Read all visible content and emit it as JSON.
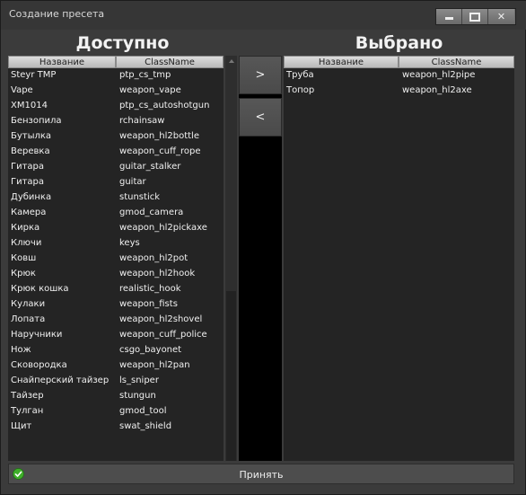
{
  "window": {
    "title": "Создание пресета",
    "controls": [
      "minimize",
      "maximize",
      "close"
    ]
  },
  "available": {
    "title": "Доступно",
    "columns": [
      "Название",
      "ClassName"
    ],
    "rows": [
      [
        "Steyr TMP",
        "ptp_cs_tmp"
      ],
      [
        "Vape",
        "weapon_vape"
      ],
      [
        "XM1014",
        "ptp_cs_autoshotgun"
      ],
      [
        "Бензопила",
        "rchainsaw"
      ],
      [
        "Бутылка",
        "weapon_hl2bottle"
      ],
      [
        "Веревка",
        "weapon_cuff_rope"
      ],
      [
        "Гитара",
        "guitar_stalker"
      ],
      [
        "Гитара",
        "guitar"
      ],
      [
        "Дубинка",
        "stunstick"
      ],
      [
        "Камера",
        "gmod_camera"
      ],
      [
        "Кирка",
        "weapon_hl2pickaxe"
      ],
      [
        "Ключи",
        "keys"
      ],
      [
        "Ковш",
        "weapon_hl2pot"
      ],
      [
        "Крюк",
        "weapon_hl2hook"
      ],
      [
        "Крюк кошка",
        "realistic_hook"
      ],
      [
        "Кулаки",
        "weapon_fists"
      ],
      [
        "Лопата",
        "weapon_hl2shovel"
      ],
      [
        "Наручники",
        "weapon_cuff_police"
      ],
      [
        "Нож",
        "csgo_bayonet"
      ],
      [
        "Сковородка",
        "weapon_hl2pan"
      ],
      [
        "Снайперский тайзер",
        "ls_sniper"
      ],
      [
        "Тайзер",
        "stungun"
      ],
      [
        "Тулган",
        "gmod_tool"
      ],
      [
        "Щит",
        "swat_shield"
      ]
    ]
  },
  "selected": {
    "title": "Выбрано",
    "columns": [
      "Название",
      "ClassName"
    ],
    "rows": [
      [
        "Труба",
        "weapon_hl2pipe"
      ],
      [
        "Топор",
        "weapon_hl2axe"
      ]
    ]
  },
  "buttons": {
    "add": ">",
    "remove": "<",
    "accept": "Принять"
  },
  "icons": {
    "accept": "check-circle-icon",
    "accept_color": "#3fae2a"
  }
}
